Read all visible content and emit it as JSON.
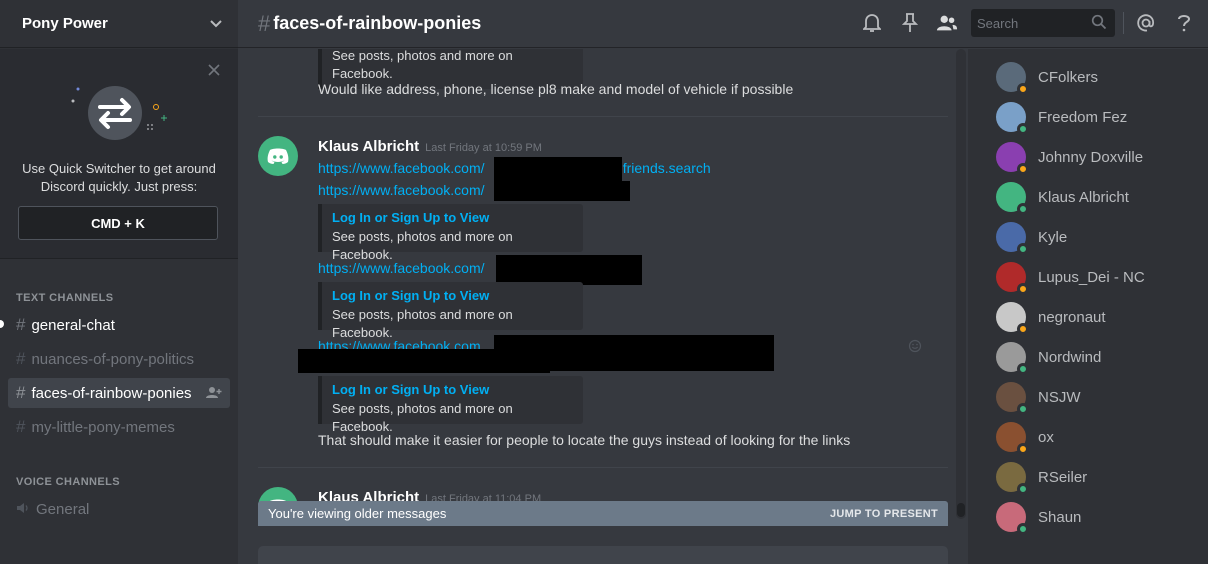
{
  "server": {
    "name": "Pony Power"
  },
  "quick_switcher": {
    "text": "Use Quick Switcher to get around Discord quickly. Just press:",
    "shortcut": "CMD + K"
  },
  "channel_categories": {
    "text": "TEXT CHANNELS",
    "voice": "VOICE CHANNELS"
  },
  "text_channels": [
    {
      "name": "general-chat",
      "state": "unread"
    },
    {
      "name": "nuances-of-pony-politics",
      "state": "normal"
    },
    {
      "name": "faces-of-rainbow-ponies",
      "state": "selected"
    },
    {
      "name": "my-little-pony-memes",
      "state": "normal"
    }
  ],
  "voice_channels": [
    {
      "name": "General"
    }
  ],
  "header": {
    "channel_name": "faces-of-rainbow-ponies",
    "search_placeholder": "Search",
    "icons": [
      "bell-icon",
      "pin-icon",
      "members-icon",
      "search-icon",
      "mention-icon",
      "help-icon"
    ]
  },
  "messages": {
    "top_embed_desc": "See posts, photos and more on Facebook.",
    "top_text": "Would like address, phone, license pl8 make and model of vehicle if possible",
    "msg1": {
      "author": "Klaus Albricht",
      "timestamp": "Last Friday at 10:59 PM",
      "link1_prefix": "https://www.facebook.com/",
      "link1_suffix": "=friends.search",
      "link2_prefix": "https://www.facebook.com/",
      "embed1_title": "Log In or Sign Up to View",
      "embed1_desc": "See posts, photos and more on Facebook.",
      "link3_prefix": "https://www.facebook.com/",
      "embed2_title": "Log In or Sign Up to View",
      "embed2_desc": "See posts, photos and more on Facebook.",
      "link4_prefix": "https://www.facebook.com.",
      "embed3_title": "Log In or Sign Up to View",
      "embed3_desc": "See posts, photos and more on Facebook.",
      "closing_text": "That should make it easier for people to locate the guys instead of looking for the links"
    },
    "msg2": {
      "author": "Klaus Albricht",
      "timestamp": "Last Friday at 11:04 PM"
    }
  },
  "older_bar": {
    "text": "You're viewing older messages",
    "jump_label": "JUMP TO PRESENT"
  },
  "members": [
    {
      "name": "CFolkers",
      "status": "idle",
      "avatar_color": "#5a6a7a"
    },
    {
      "name": "Freedom Fez",
      "status": "online",
      "avatar_color": "#7aa0c8"
    },
    {
      "name": "Johnny Doxville",
      "status": "idle",
      "avatar_color": "#8a3fb0"
    },
    {
      "name": "Klaus Albricht",
      "status": "online",
      "avatar_color": "#43b581"
    },
    {
      "name": "Kyle",
      "status": "online",
      "avatar_color": "#4a6aa8"
    },
    {
      "name": "Lupus_Dei - NC",
      "status": "idle",
      "avatar_color": "#b02a2a"
    },
    {
      "name": "negronaut",
      "status": "idle",
      "avatar_color": "#c8c8c8"
    },
    {
      "name": "Nordwind",
      "status": "online",
      "avatar_color": "#9a9a9a"
    },
    {
      "name": "NSJW",
      "status": "online",
      "avatar_color": "#6a5040"
    },
    {
      "name": "ox",
      "status": "idle",
      "avatar_color": "#8a5030"
    },
    {
      "name": "RSeiler",
      "status": "online",
      "avatar_color": "#7a6a40"
    },
    {
      "name": "Shaun",
      "status": "online",
      "avatar_color": "#c86a7a"
    }
  ],
  "colors": {
    "online": "#43b581",
    "idle": "#faa61a",
    "link": "#00b0f4",
    "brand": "#43b581"
  }
}
